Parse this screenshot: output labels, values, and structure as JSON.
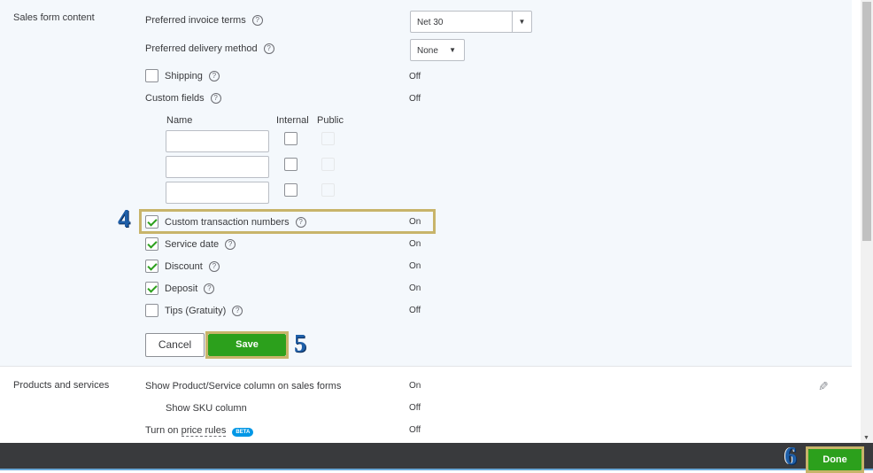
{
  "sales_form": {
    "title": "Sales form content",
    "invoice_terms": {
      "label": "Preferred invoice terms",
      "value": "Net 30"
    },
    "delivery": {
      "label": "Preferred delivery method",
      "value": "None"
    },
    "shipping": {
      "label": "Shipping",
      "status": "Off",
      "checked": false
    },
    "custom_fields": {
      "label": "Custom fields",
      "status": "Off",
      "col_name": "Name",
      "col_internal": "Internal",
      "col_public": "Public"
    },
    "options": [
      {
        "label": "Custom transaction numbers",
        "status": "On",
        "checked": true
      },
      {
        "label": "Service date",
        "status": "On",
        "checked": true
      },
      {
        "label": "Discount",
        "status": "On",
        "checked": true
      },
      {
        "label": "Deposit",
        "status": "On",
        "checked": true
      },
      {
        "label": "Tips (Gratuity)",
        "status": "Off",
        "checked": false
      }
    ],
    "cancel": "Cancel",
    "save": "Save"
  },
  "products": {
    "title": "Products and services",
    "rows": [
      {
        "label": "Show Product/Service column on sales forms",
        "status": "On"
      },
      {
        "label": "Show SKU column",
        "status": "Off"
      }
    ],
    "price_prefix": "Turn on",
    "price_link": "price rules",
    "beta": "BETA",
    "price_status": "Off"
  },
  "footer": {
    "done": "Done"
  },
  "steps": [
    "4",
    "5",
    "6"
  ],
  "help_glyph": "?",
  "icons": {
    "help": "question-circle-icon",
    "edit": "pencil-icon",
    "dropdown": "caret-down-icon"
  },
  "colors": {
    "accent": "#2ca01c",
    "highlight": "#c8b46a",
    "footer": "#393a3d",
    "beta": "#0097e6"
  }
}
